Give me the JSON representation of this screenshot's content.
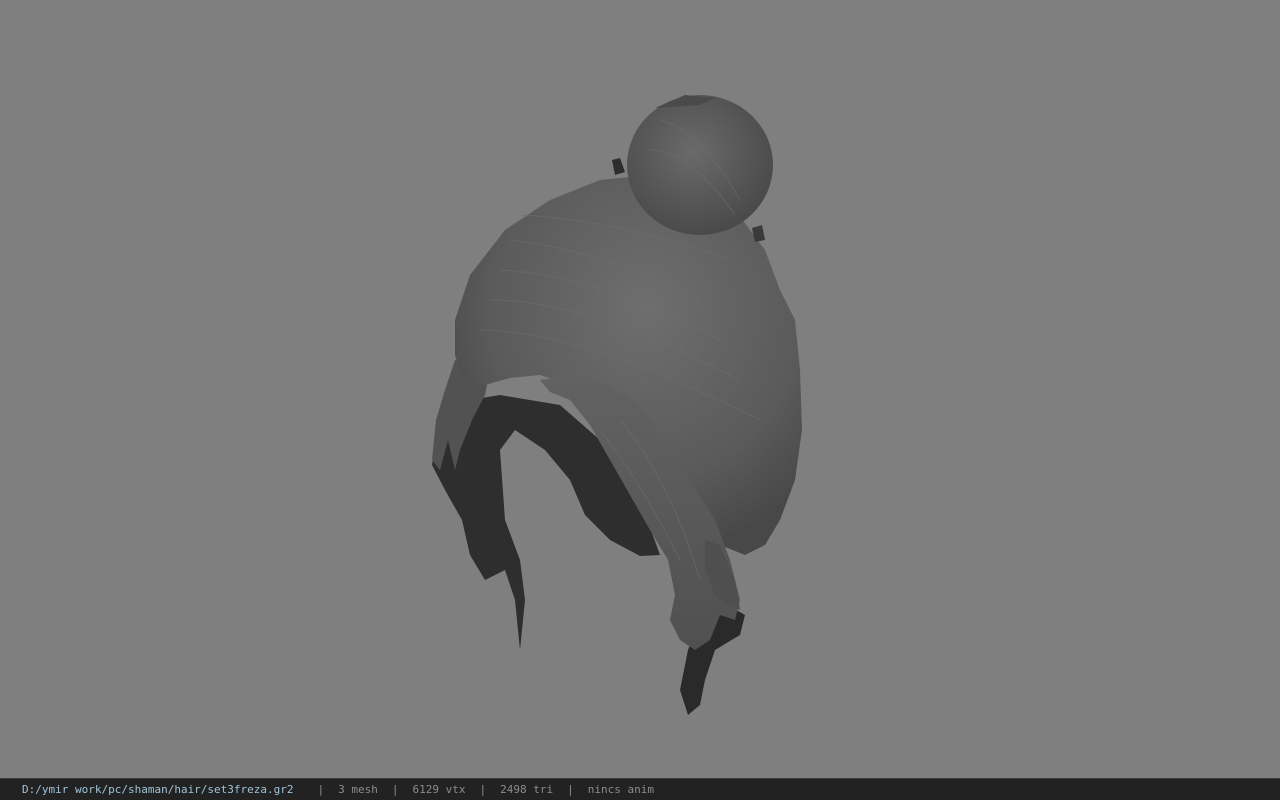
{
  "viewer": {
    "background_color": "#7f7f7f",
    "model": {
      "name": "hair-mesh",
      "base_color": "#5c5c5c"
    }
  },
  "status_bar": {
    "file_path": "D:/ymir work/pc/shaman/hair/set3freza.gr2",
    "separator": "|",
    "mesh_count": "3 mesh",
    "vertex_count": "6129 vtx",
    "triangle_count": "2498 tri",
    "anim_status": "nincs anim"
  }
}
